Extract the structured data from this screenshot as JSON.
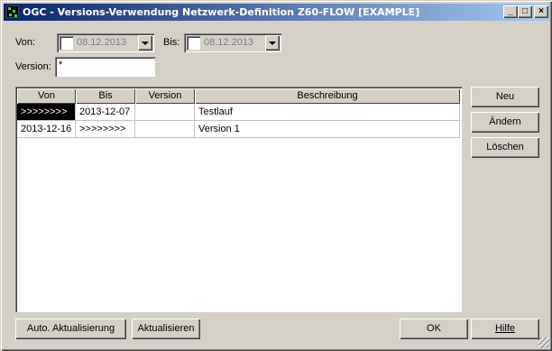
{
  "window": {
    "title": "OGC - Versions-Verwendung Netzwerk-Definition Z60-FLOW [EXAMPLE]",
    "minimize": "_",
    "maximize": "□",
    "close": "×"
  },
  "filters": {
    "von_label": "Von:",
    "von_date": "08.12.2013",
    "bis_label": "Bis:",
    "bis_date": "08.12.2013",
    "version_label": "Version:",
    "version_value": "*"
  },
  "table": {
    "columns": [
      "Von",
      "Bis",
      "Version",
      "Beschreibung"
    ],
    "rows": [
      {
        "von": ">>>>>>>>",
        "bis": "2013-12-07",
        "version": "",
        "beschreibung": "Testlauf"
      },
      {
        "von": "2013-12-16",
        "bis": ">>>>>>>>",
        "version": "",
        "beschreibung": "Version 1"
      }
    ]
  },
  "side_buttons": {
    "new": "Neu",
    "change": "Ändern",
    "delete": "Löschen"
  },
  "bottom_buttons": {
    "auto_refresh": "Auto. Aktualisierung",
    "refresh": "Aktualisieren",
    "ok": "OK",
    "help": "Hilfe"
  },
  "colors": {
    "title_start": "#0a246a",
    "title_end": "#a6caf0",
    "face": "#d4d0c8"
  }
}
